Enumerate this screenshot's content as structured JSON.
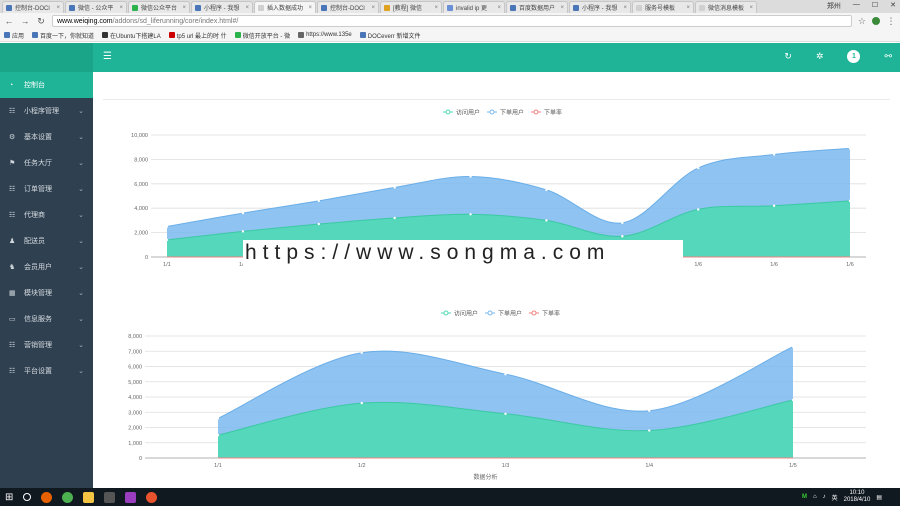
{
  "browser": {
    "tabs": [
      {
        "label": "控制台-DOCl",
        "color": "#4a76b8"
      },
      {
        "label": "微信 - 公众平",
        "color": "#4a76b8"
      },
      {
        "label": "微信公众平台",
        "color": "#2bb24c"
      },
      {
        "label": "小程序 - 我想",
        "color": "#4a76b8"
      },
      {
        "label": "插入数据成功",
        "color": "#d0d0d0"
      },
      {
        "label": "控制台-DOCl",
        "color": "#4a76b8"
      },
      {
        "label": "[教程] 微信",
        "color": "#e0a020"
      },
      {
        "label": "invalid ip 更",
        "color": "#6a8fd6"
      },
      {
        "label": "百度数据用户",
        "color": "#4a76b8"
      },
      {
        "label": "小程序 - 我想",
        "color": "#4a76b8"
      },
      {
        "label": "服务号模板",
        "color": "#d0d0d0"
      },
      {
        "label": "微信消息模板",
        "color": "#d0d0d0"
      }
    ],
    "window_title_right": "郑州",
    "url_host": "www.weiqing.com",
    "url_path": "/addons/sd_liferunning/core/index.html#/",
    "bookmarks": [
      "应用",
      "百度一下，你就知道",
      "在Ubuntu下搭建LA",
      "tp5 url 最上的时 什",
      "微信开放平台 - 微",
      "https://www.135e",
      "DOCeverr 新增文件"
    ]
  },
  "header": {
    "menu_icon": "hamburger-icon",
    "icons": [
      "refresh-icon",
      "settings-icon",
      "user-avatar",
      "share-icon"
    ],
    "avatar_text": "1"
  },
  "sidebar": {
    "items": [
      {
        "label": "控制台",
        "icon": "dashboard-icon",
        "active": true
      },
      {
        "label": "小程序管理",
        "icon": "list-icon",
        "active": false
      },
      {
        "label": "基本设置",
        "icon": "gear-icon",
        "active": false
      },
      {
        "label": "任务大厅",
        "icon": "flag-icon",
        "active": false
      },
      {
        "label": "订单管理",
        "icon": "list-icon",
        "active": false
      },
      {
        "label": "代理商",
        "icon": "list-icon",
        "active": false
      },
      {
        "label": "配送员",
        "icon": "user-icon",
        "active": false
      },
      {
        "label": "会员用户",
        "icon": "users-icon",
        "active": false
      },
      {
        "label": "模块管理",
        "icon": "grid-icon",
        "active": false
      },
      {
        "label": "信息服务",
        "icon": "card-icon",
        "active": false
      },
      {
        "label": "营销管理",
        "icon": "list-icon",
        "active": false
      },
      {
        "label": "平台设置",
        "icon": "list-icon",
        "active": false
      }
    ]
  },
  "watermark": "https://www.songma.com",
  "chart_data": [
    {
      "type": "area",
      "legend": [
        "访问用户",
        "下单用户",
        "下单率"
      ],
      "colors": {
        "visit": "#4ed9b4",
        "order": "#7ab8f0",
        "rate": "#f08080"
      },
      "x": [
        "1/1",
        "1/2",
        "1/3",
        "1/4",
        "1/5",
        "1/6",
        "1/6",
        "1/6",
        "1/6",
        "1/6"
      ],
      "ylim": [
        0,
        10000
      ],
      "yticks": [
        "0",
        "2,000",
        "4,000",
        "6,000",
        "8,000",
        "10,000"
      ],
      "series": [
        {
          "name": "访问用户",
          "values": [
            1400,
            2100,
            2700,
            3200,
            3500,
            3000,
            1700,
            3900,
            4200,
            4600
          ]
        },
        {
          "name": "下单用户",
          "values": [
            2500,
            3600,
            4600,
            5700,
            6600,
            5500,
            2800,
            7300,
            8400,
            8900
          ]
        },
        {
          "name": "下单率",
          "values": [
            0,
            0,
            0,
            0,
            0,
            0,
            0,
            0,
            0,
            0
          ]
        }
      ]
    },
    {
      "type": "area",
      "legend": [
        "访问用户",
        "下单用户",
        "下单率"
      ],
      "colors": {
        "visit": "#4ed9b4",
        "order": "#7ab8f0",
        "rate": "#f08080"
      },
      "x": [
        "1/1",
        "1/2",
        "1/3",
        "1/4",
        "1/5"
      ],
      "ylim": [
        0,
        8000
      ],
      "yticks": [
        "0",
        "1,000",
        "2,000",
        "3,000",
        "4,000",
        "5,000",
        "6,000",
        "7,000",
        "8,000"
      ],
      "xlabel": "数据分析",
      "series": [
        {
          "name": "访问用户",
          "values": [
            1500,
            3600,
            2900,
            1800,
            3800
          ]
        },
        {
          "name": "下单用户",
          "values": [
            2600,
            6900,
            5500,
            3100,
            7300
          ]
        },
        {
          "name": "下单率",
          "values": [
            0,
            0,
            0,
            0,
            0
          ]
        }
      ]
    }
  ],
  "taskbar": {
    "time": "10:10",
    "date": "2018/4/10",
    "ime": "英",
    "tray_label": "M"
  }
}
